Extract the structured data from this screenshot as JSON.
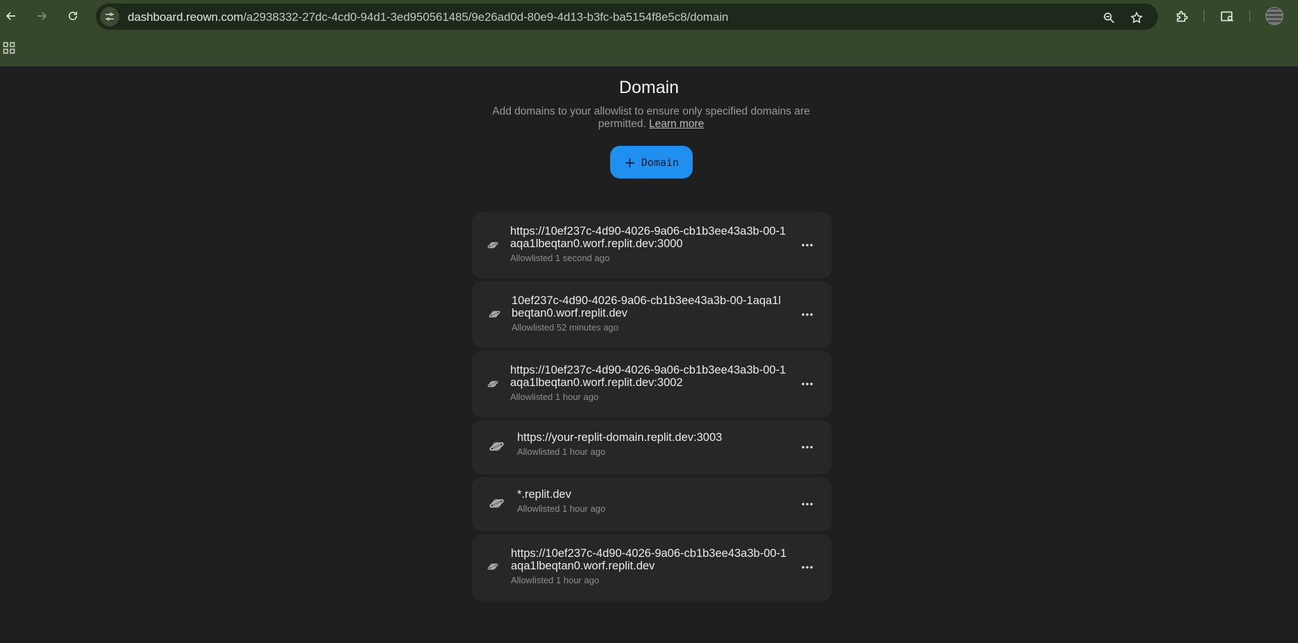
{
  "browser": {
    "url_host": "dashboard.reown.com",
    "url_path": "/a2938332-27dc-4cd0-94d1-3ed950561485/9e26ad0d-80e9-4d13-b3fc-ba5154f8e5c8/domain",
    "icons": [
      "back-icon",
      "forward-icon",
      "reload-icon",
      "site-info-icon",
      "zoom-icon",
      "bookmark-star-icon",
      "extensions-icon",
      "tab-search-icon",
      "profile-avatar",
      "apps-grid-icon"
    ]
  },
  "page": {
    "title": "Domain",
    "subtitle": "Add domains to your allowlist to ensure only specified domains are permitted.",
    "learn_more": "Learn more",
    "add_button_label": "Domain",
    "add_button_icon": "plus-icon"
  },
  "domains": [
    {
      "domain": "https://10ef237c-4d90-4026-9a06-cb1b3ee43a3b-00-1aqa1lbeqtan0.worf.replit.dev:3000",
      "status": "Allowlisted 1 second ago",
      "icon": "planet-icon"
    },
    {
      "domain": "10ef237c-4d90-4026-9a06-cb1b3ee43a3b-00-1aqa1lbeqtan0.worf.replit.dev",
      "status": "Allowlisted 52 minutes ago",
      "icon": "planet-icon"
    },
    {
      "domain": "https://10ef237c-4d90-4026-9a06-cb1b3ee43a3b-00-1aqa1lbeqtan0.worf.replit.dev:3002",
      "status": "Allowlisted 1 hour ago",
      "icon": "planet-icon"
    },
    {
      "domain": "https://your-replit-domain.replit.dev:3003",
      "status": "Allowlisted 1 hour ago",
      "icon": "planet-icon"
    },
    {
      "domain": "*.replit.dev",
      "status": "Allowlisted 1 hour ago",
      "icon": "planet-icon"
    },
    {
      "domain": "https://10ef237c-4d90-4026-9a06-cb1b3ee43a3b-00-1aqa1lbeqtan0.worf.replit.dev",
      "status": "Allowlisted 1 hour ago",
      "icon": "planet-icon"
    }
  ]
}
